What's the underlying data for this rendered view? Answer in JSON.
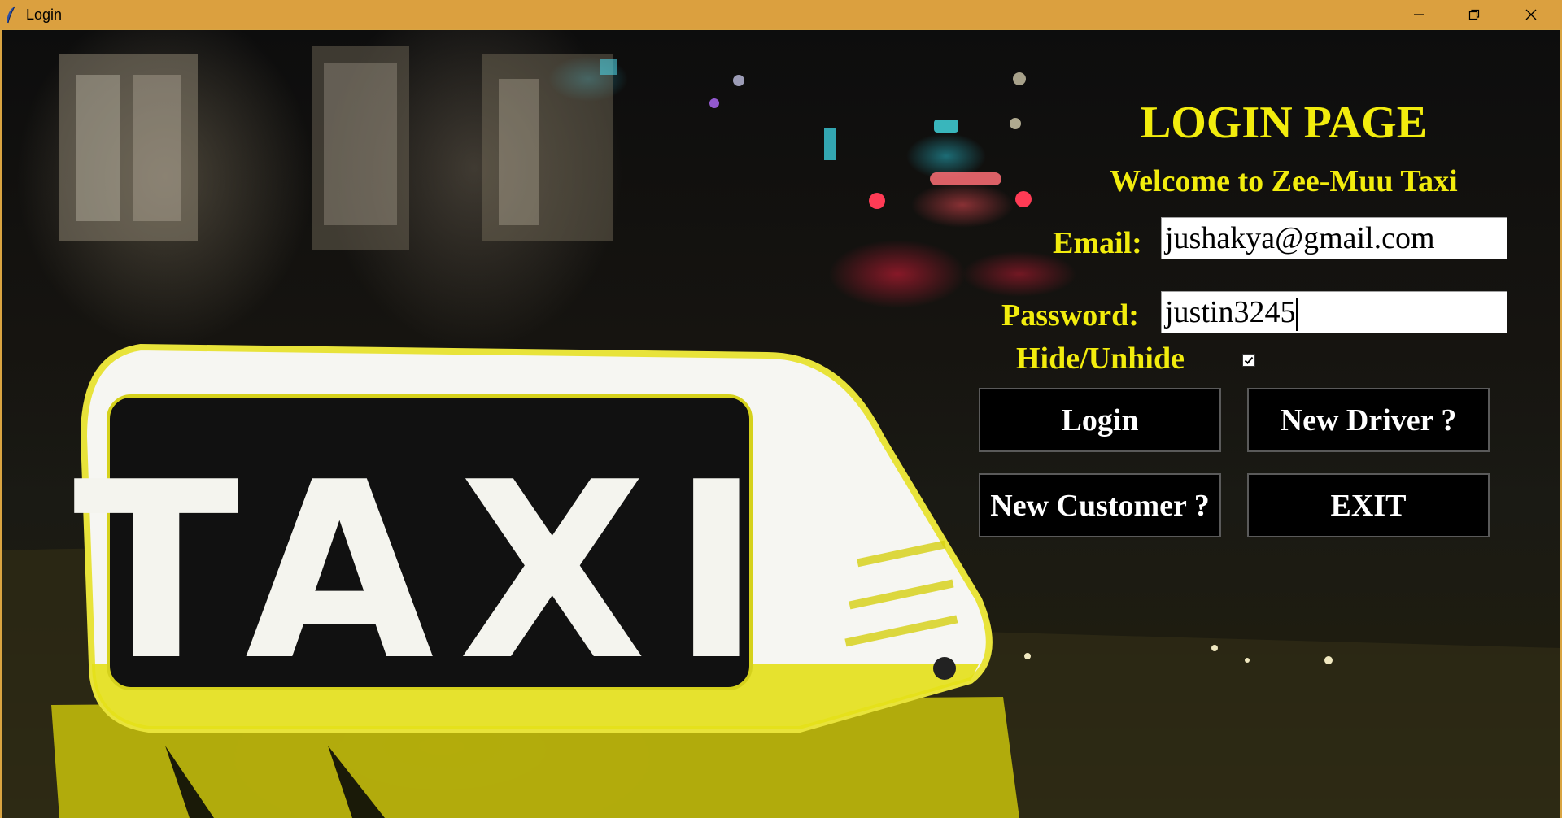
{
  "window": {
    "title": "Login",
    "controls": {
      "minimize": "minimize-icon",
      "maximize": "restore-icon",
      "close": "close-icon"
    }
  },
  "background": {
    "sign_text": "TAXI",
    "accent": "#f2ec0d"
  },
  "login": {
    "heading": "LOGIN PAGE",
    "welcome": "Welcome to Zee-Muu Taxi",
    "email_label": "Email:",
    "email_value": "jushakya@gmail.com",
    "password_label": "Password:",
    "password_value": "justin3245",
    "hide_label": "Hide/Unhide",
    "hide_checked": true
  },
  "buttons": {
    "login": "Login",
    "new_driver": "New Driver ?",
    "new_customer": "New Customer ?",
    "exit": "EXIT"
  }
}
